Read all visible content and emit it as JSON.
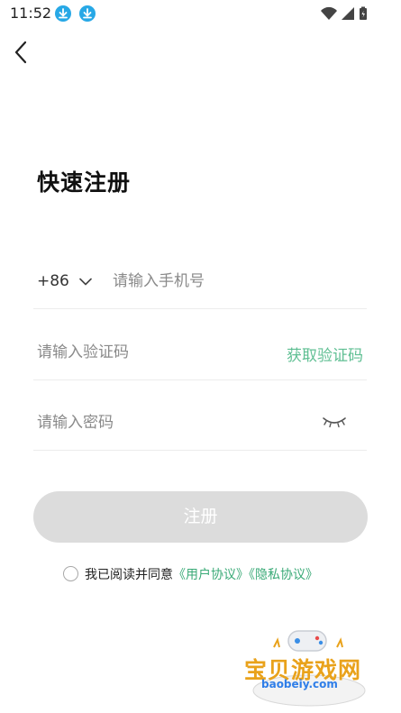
{
  "status_bar": {
    "time": "11:52",
    "icons": [
      "download-icon",
      "download-icon",
      "wifi-icon",
      "signal-icon",
      "battery-icon"
    ]
  },
  "nav": {
    "back_icon": "chevron-left-icon"
  },
  "title": "快速注册",
  "phone": {
    "country_code": "+86",
    "placeholder": "请输入手机号"
  },
  "code": {
    "placeholder": "请输入验证码",
    "get_code_label": "获取验证码"
  },
  "password": {
    "placeholder": "请输入密码",
    "eye_icon": "eye-closed-icon"
  },
  "submit_label": "注册",
  "agreement": {
    "checked": false,
    "text": "我已阅读并同意",
    "user_agreement": "《用户协议》",
    "privacy_agreement": "《隐私协议》"
  },
  "watermark": {
    "title": "宝贝游戏网",
    "url": "baobeiy.com"
  },
  "colors": {
    "accent_green": "#5fbf93",
    "link_green": "#3aaa77",
    "button_disabled": "#dcdcdc",
    "download_badge": "#27a8e6"
  }
}
